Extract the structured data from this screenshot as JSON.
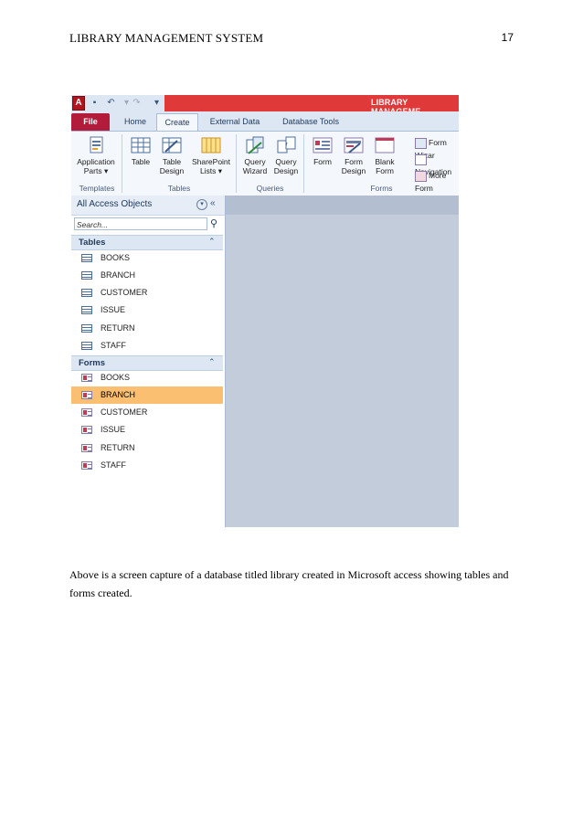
{
  "doc_header": {
    "title": "LIBRARY MANAGEMENT SYSTEM",
    "page_number": "17"
  },
  "app": {
    "title": "LIBRARY MANAGEME",
    "tabs": [
      "File",
      "Home",
      "Create",
      "External Data",
      "Database Tools"
    ],
    "active_tab": "Create",
    "ribbon": {
      "buttons": [
        {
          "line1": "Application",
          "line2": "Parts ▾"
        },
        {
          "line1": "Table",
          "line2": ""
        },
        {
          "line1": "Table",
          "line2": "Design"
        },
        {
          "line1": "SharePoint",
          "line2": "Lists ▾"
        },
        {
          "line1": "Query",
          "line2": "Wizard"
        },
        {
          "line1": "Query",
          "line2": "Design"
        },
        {
          "line1": "Form",
          "line2": ""
        },
        {
          "line1": "Form",
          "line2": "Design"
        },
        {
          "line1": "Blank",
          "line2": "Form"
        }
      ],
      "small_buttons": [
        "Form Wizar",
        "Navigation",
        "More Form"
      ],
      "groups": [
        "Templates",
        "Tables",
        "Queries",
        "Forms"
      ]
    },
    "nav": {
      "header": "All Access Objects",
      "search_placeholder": "Search...",
      "sections": [
        {
          "label": "Tables",
          "items": [
            "BOOKS",
            "BRANCH",
            "CUSTOMER",
            "ISSUE",
            "RETURN",
            "STAFF"
          ]
        },
        {
          "label": "Forms",
          "items": [
            "BOOKS",
            "BRANCH",
            "CUSTOMER",
            "ISSUE",
            "RETURN",
            "STAFF"
          ]
        }
      ],
      "selected": "Forms / BRANCH"
    }
  },
  "caption": "Above is a screen capture of a database titled library created in Microsoft access showing tables and forms created.",
  "colors": {
    "title_bar": "#e03939",
    "file_tab": "#b31b3b",
    "selected_item": "#fbbf71",
    "workspace": "#c2ccdb"
  }
}
